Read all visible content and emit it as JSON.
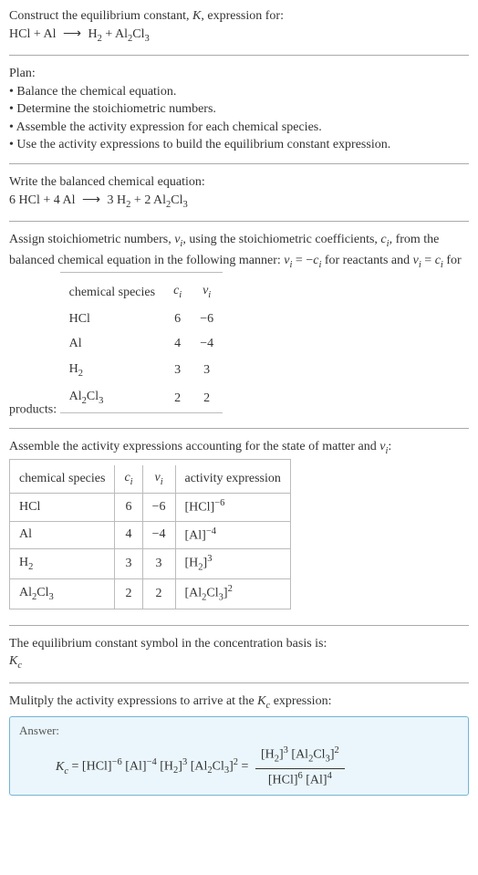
{
  "intro": {
    "line1": "Construct the equilibrium constant, ",
    "K": "K",
    "line1b": ", expression for:",
    "equation_lhs": "HCl + Al",
    "arrow": "⟶",
    "equation_rhs1": "H",
    "equation_rhs1_sub": "2",
    "equation_rhs2": " + Al",
    "equation_rhs2_sub1": "2",
    "equation_rhs2_cl": "Cl",
    "equation_rhs2_sub2": "3"
  },
  "plan": {
    "header": "Plan:",
    "b1": "• Balance the chemical equation.",
    "b2": "• Determine the stoichiometric numbers.",
    "b3": "• Assemble the activity expression for each chemical species.",
    "b4": "• Use the activity expressions to build the equilibrium constant expression."
  },
  "balanced": {
    "header": "Write the balanced chemical equation:",
    "lhs1_coef": "6 HCl + 4 Al",
    "arrow": "⟶",
    "rhs1": "3 H",
    "rhs1_sub": "2",
    "rhs2": " + 2 Al",
    "rhs2_sub1": "2",
    "rhs2_cl": "Cl",
    "rhs2_sub2": "3"
  },
  "stoich": {
    "line1a": "Assign stoichiometric numbers, ",
    "vi": "ν",
    "vi_sub": "i",
    "line1b": ", using the stoichiometric coefficients, ",
    "ci": "c",
    "ci_sub": "i",
    "line1c": ", from the balanced chemical equation in the following manner: ",
    "rel1a": "ν",
    "rel1a_sub": "i",
    "rel1_eq": " = −",
    "rel1b": "c",
    "rel1b_sub": "i",
    "line1d": " for reactants and ",
    "rel2a": "ν",
    "rel2a_sub": "i",
    "rel2_eq": " = ",
    "rel2b": "c",
    "rel2b_sub": "i",
    "line1e": " for products:",
    "headers": {
      "h1": "chemical species",
      "h2": "c",
      "h2_sub": "i",
      "h3": "ν",
      "h3_sub": "i"
    },
    "rows": [
      {
        "sp": "HCl",
        "spsub1": "",
        "spmid": "",
        "spsub2": "",
        "ci": "6",
        "vi": "−6"
      },
      {
        "sp": "Al",
        "spsub1": "",
        "spmid": "",
        "spsub2": "",
        "ci": "4",
        "vi": "−4"
      },
      {
        "sp": "H",
        "spsub1": "2",
        "spmid": "",
        "spsub2": "",
        "ci": "3",
        "vi": "3"
      },
      {
        "sp": "Al",
        "spsub1": "2",
        "spmid": "Cl",
        "spsub2": "3",
        "ci": "2",
        "vi": "2"
      }
    ]
  },
  "activity": {
    "header_a": "Assemble the activity expressions accounting for the state of matter and ",
    "vi": "ν",
    "vi_sub": "i",
    "header_b": ":",
    "headers": {
      "h1": "chemical species",
      "h2": "c",
      "h2_sub": "i",
      "h3": "ν",
      "h3_sub": "i",
      "h4": "activity expression"
    },
    "rows": [
      {
        "sp": "HCl",
        "spsub1": "",
        "spmid": "",
        "spsub2": "",
        "ci": "6",
        "vi": "−6",
        "ae_in": "[HCl]",
        "ae_sup": "−6"
      },
      {
        "sp": "Al",
        "spsub1": "",
        "spmid": "",
        "spsub2": "",
        "ci": "4",
        "vi": "−4",
        "ae_in": "[Al]",
        "ae_sup": "−4"
      },
      {
        "sp": "H",
        "spsub1": "2",
        "spmid": "",
        "spsub2": "",
        "ci": "3",
        "vi": "3",
        "ae_in_a": "[H",
        "ae_in_sub": "2",
        "ae_in_b": "]",
        "ae_sup": "3"
      },
      {
        "sp": "Al",
        "spsub1": "2",
        "spmid": "Cl",
        "spsub2": "3",
        "ci": "2",
        "vi": "2",
        "ae_in_a": "[Al",
        "ae_in_sub": "2",
        "ae_in_mid": "Cl",
        "ae_in_sub2": "3",
        "ae_in_b": "]",
        "ae_sup": "2"
      }
    ]
  },
  "eqconst": {
    "line": "The equilibrium constant symbol in the concentration basis is:",
    "symbol": "K",
    "symbol_sub": "c"
  },
  "mult": {
    "line_a": "Mulitply the activity expressions to arrive at the ",
    "kc": "K",
    "kc_sub": "c",
    "line_b": " expression:"
  },
  "answer": {
    "label": "Answer:",
    "kc": "K",
    "kc_sub": "c",
    "eq": " = ",
    "t1": "[HCl]",
    "t1_sup": "−6",
    "t2": " [Al]",
    "t2_sup": "−4",
    "t3a": " [H",
    "t3_sub": "2",
    "t3b": "]",
    "t3_sup": "3",
    "t4a": " [Al",
    "t4_sub1": "2",
    "t4_mid": "Cl",
    "t4_sub2": "3",
    "t4b": "]",
    "t4_sup": "2",
    "eq2": " = ",
    "num_a": "[H",
    "num_sub": "2",
    "num_b": "]",
    "num_sup": "3",
    "num2_a": " [Al",
    "num2_sub1": "2",
    "num2_mid": "Cl",
    "num2_sub2": "3",
    "num2_b": "]",
    "num2_sup": "2",
    "den_a": "[HCl]",
    "den_a_sup": "6",
    "den_b": " [Al]",
    "den_b_sup": "4"
  }
}
